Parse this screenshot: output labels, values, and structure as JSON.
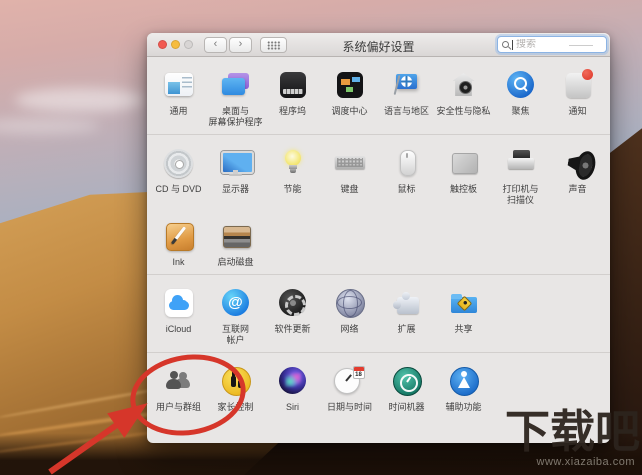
{
  "desktop": {
    "watermark": {
      "title": "下载吧",
      "url": "www.xiazaiba.com"
    }
  },
  "annotation": {
    "color": "#d6362a",
    "target_label": "用户与群组"
  },
  "window": {
    "title": "系统偏好设置",
    "traffic_lights": {
      "close": "#f25a52",
      "minimize": "#f6bc3e",
      "zoom": "#d8d5d4"
    },
    "nav": {
      "back": "‹",
      "forward": "›"
    },
    "search": {
      "placeholder": "搜索"
    },
    "grid": {
      "dividers_after": [
        0,
        2,
        3
      ],
      "rows": [
        {
          "items": [
            {
              "name": "general",
              "icon": "general",
              "label": [
                "通用"
              ]
            },
            {
              "name": "desktop-screensaver",
              "icon": "desktop",
              "label": [
                "桌面与",
                "屏幕保护程序"
              ]
            },
            {
              "name": "dock",
              "icon": "dock",
              "label": [
                "程序坞"
              ]
            },
            {
              "name": "mission-control",
              "icon": "mission",
              "label": [
                "调度中心"
              ]
            },
            {
              "name": "language-region",
              "icon": "language",
              "label": [
                "语言与地区"
              ]
            },
            {
              "name": "security-privacy",
              "icon": "security",
              "label": [
                "安全性与隐私"
              ]
            },
            {
              "name": "spotlight",
              "icon": "spotlight",
              "label": [
                "聚焦"
              ]
            },
            {
              "name": "notifications",
              "icon": "notifications",
              "label": [
                "通知"
              ]
            }
          ]
        },
        {
          "items": [
            {
              "name": "cd-dvd",
              "icon": "cd",
              "label": [
                "CD 与 DVD"
              ]
            },
            {
              "name": "displays",
              "icon": "display",
              "label": [
                "显示器"
              ]
            },
            {
              "name": "energy-saver",
              "icon": "energy",
              "label": [
                "节能"
              ]
            },
            {
              "name": "keyboard",
              "icon": "keyboard",
              "label": [
                "键盘"
              ]
            },
            {
              "name": "mouse",
              "icon": "mouse",
              "label": [
                "鼠标"
              ]
            },
            {
              "name": "trackpad",
              "icon": "trackpad",
              "label": [
                "触控板"
              ]
            },
            {
              "name": "printers-scanners",
              "icon": "printer",
              "label": [
                "打印机与",
                "扫描仪"
              ]
            },
            {
              "name": "sound",
              "icon": "sound",
              "label": [
                "声音"
              ]
            }
          ]
        },
        {
          "items": [
            {
              "name": "ink",
              "icon": "ink",
              "label": [
                "Ink"
              ]
            },
            {
              "name": "startup-disk",
              "icon": "startupdisk",
              "label": [
                "启动磁盘"
              ]
            }
          ]
        },
        {
          "items": [
            {
              "name": "icloud",
              "icon": "icloud",
              "label": [
                "iCloud"
              ]
            },
            {
              "name": "internet-accounts",
              "icon": "internet",
              "label": [
                "互联网",
                "帐户"
              ]
            },
            {
              "name": "software-update",
              "icon": "update",
              "label": [
                "软件更新"
              ]
            },
            {
              "name": "network",
              "icon": "network",
              "label": [
                "网络"
              ]
            },
            {
              "name": "extensions",
              "icon": "extensions",
              "label": [
                "扩展"
              ]
            },
            {
              "name": "sharing",
              "icon": "sharing",
              "label": [
                "共享"
              ]
            }
          ]
        },
        {
          "items": [
            {
              "name": "users-groups",
              "icon": "users",
              "label": [
                "用户与群组"
              ],
              "highlighted": true
            },
            {
              "name": "parental-controls",
              "icon": "parental",
              "label": [
                "家长控制"
              ]
            },
            {
              "name": "siri",
              "icon": "siri",
              "label": [
                "Siri"
              ]
            },
            {
              "name": "date-time",
              "icon": "datetime",
              "label": [
                "日期与时间"
              ],
              "badge": "18"
            },
            {
              "name": "time-machine",
              "icon": "timemachine",
              "label": [
                "时间机器"
              ]
            },
            {
              "name": "accessibility",
              "icon": "accessibility",
              "label": [
                "辅助功能"
              ]
            }
          ]
        }
      ]
    }
  }
}
